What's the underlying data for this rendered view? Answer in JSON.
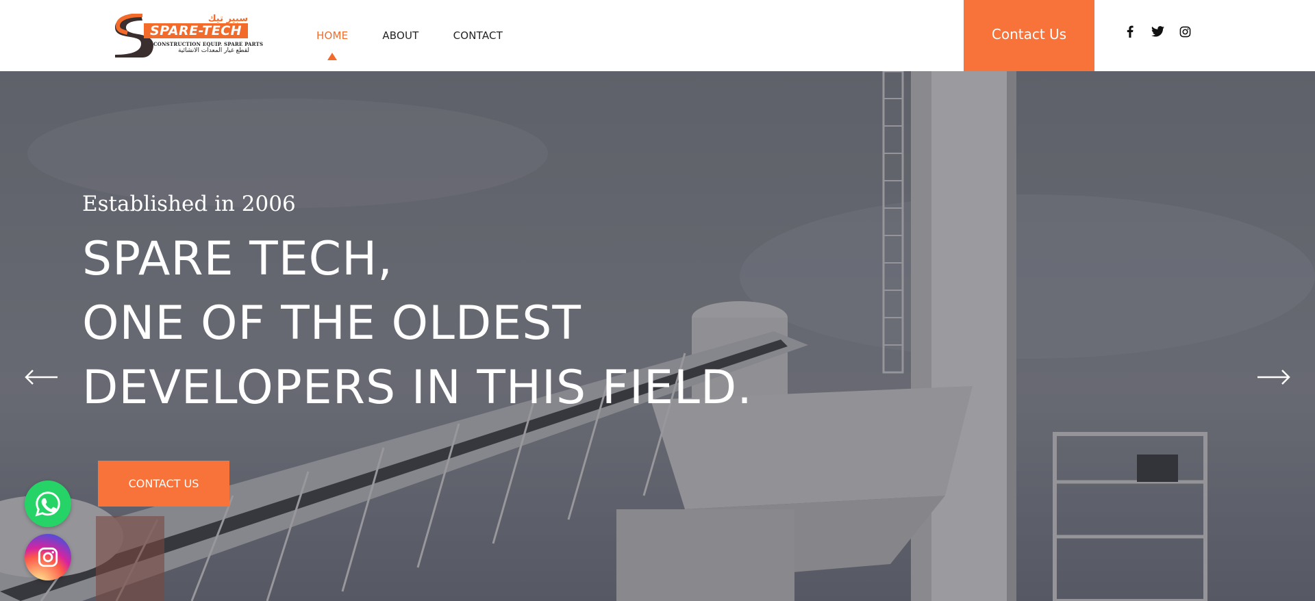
{
  "header": {
    "logo": {
      "arabic_name": "سبير تيك",
      "wordmark": "SPARE-TECH",
      "subtitle": "CONSTRUCTION EQUIP. SPARE PARTS",
      "arabic_subtitle": "لقطع غيار المعدات الانشائية"
    },
    "nav": [
      {
        "label": "HOME",
        "active": true
      },
      {
        "label": "ABOUT",
        "active": false
      },
      {
        "label": "CONTACT",
        "active": false
      }
    ],
    "cta_label": "Contact Us",
    "social": [
      "facebook-icon",
      "twitter-icon",
      "instagram-icon"
    ]
  },
  "hero": {
    "established": "Established in 2006",
    "title_lines": [
      "SPARE TECH,",
      "ONE OF THE OLDEST",
      "DEVELOPERS IN THIS FIELD."
    ],
    "button_label": "CONTACT US",
    "prev_arrow": "arrow-left-icon",
    "next_arrow": "arrow-right-icon"
  },
  "floating": [
    "whatsapp-icon",
    "instagram-icon"
  ],
  "colors": {
    "accent": "#f7733a",
    "text_dark": "#222222",
    "hero_text": "#ffffff"
  }
}
